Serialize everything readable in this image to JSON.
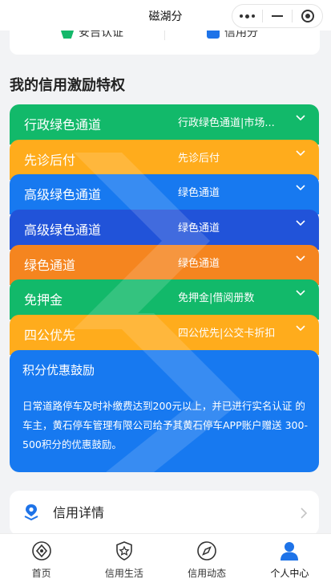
{
  "app": {
    "title": "磁湖分"
  },
  "quick_links": [
    {
      "label": "安吉认证"
    },
    {
      "label": "信用分"
    }
  ],
  "section": {
    "title": "我的信用激励特权"
  },
  "privileges": [
    {
      "name": "行政绿色通道",
      "value": "行政绿色通道|市场...",
      "color": "#12b96a"
    },
    {
      "name": "先诊后付",
      "value": "先诊后付",
      "color": "#ffac1c"
    },
    {
      "name": "高级绿色通道",
      "value": "绿色通道",
      "color": "#1779f0"
    },
    {
      "name": "高级绿色通道",
      "value": "绿色通道",
      "color": "#2153d9"
    },
    {
      "name": "绿色通道",
      "value": "绿色通道",
      "color": "#f5851f"
    },
    {
      "name": "免押金",
      "value": "免押金|借阅册数",
      "color": "#12b96a"
    },
    {
      "name": "四公优先",
      "value": "四公优先|公交卡折扣",
      "color": "#ffac1c"
    }
  ],
  "expanded": {
    "title": "积分优惠鼓励",
    "body": "日常道路停车及时补缴费达到200元以上，并已进行实名认证 的车主，黄石停车管理有限公司给予其黄石停车APP账户赠送 300-500积分的优惠鼓励。",
    "color": "#1779f0"
  },
  "detail": {
    "label": "信用详情"
  },
  "tabs": [
    {
      "label": "首页",
      "icon": "home-diamond-icon"
    },
    {
      "label": "信用生活",
      "icon": "shield-star-icon"
    },
    {
      "label": "信用动态",
      "icon": "compass-icon"
    },
    {
      "label": "个人中心",
      "icon": "person-icon",
      "active": true
    }
  ],
  "colors": {
    "accent": "#1779f0",
    "active_tab": "#1e73e8"
  }
}
